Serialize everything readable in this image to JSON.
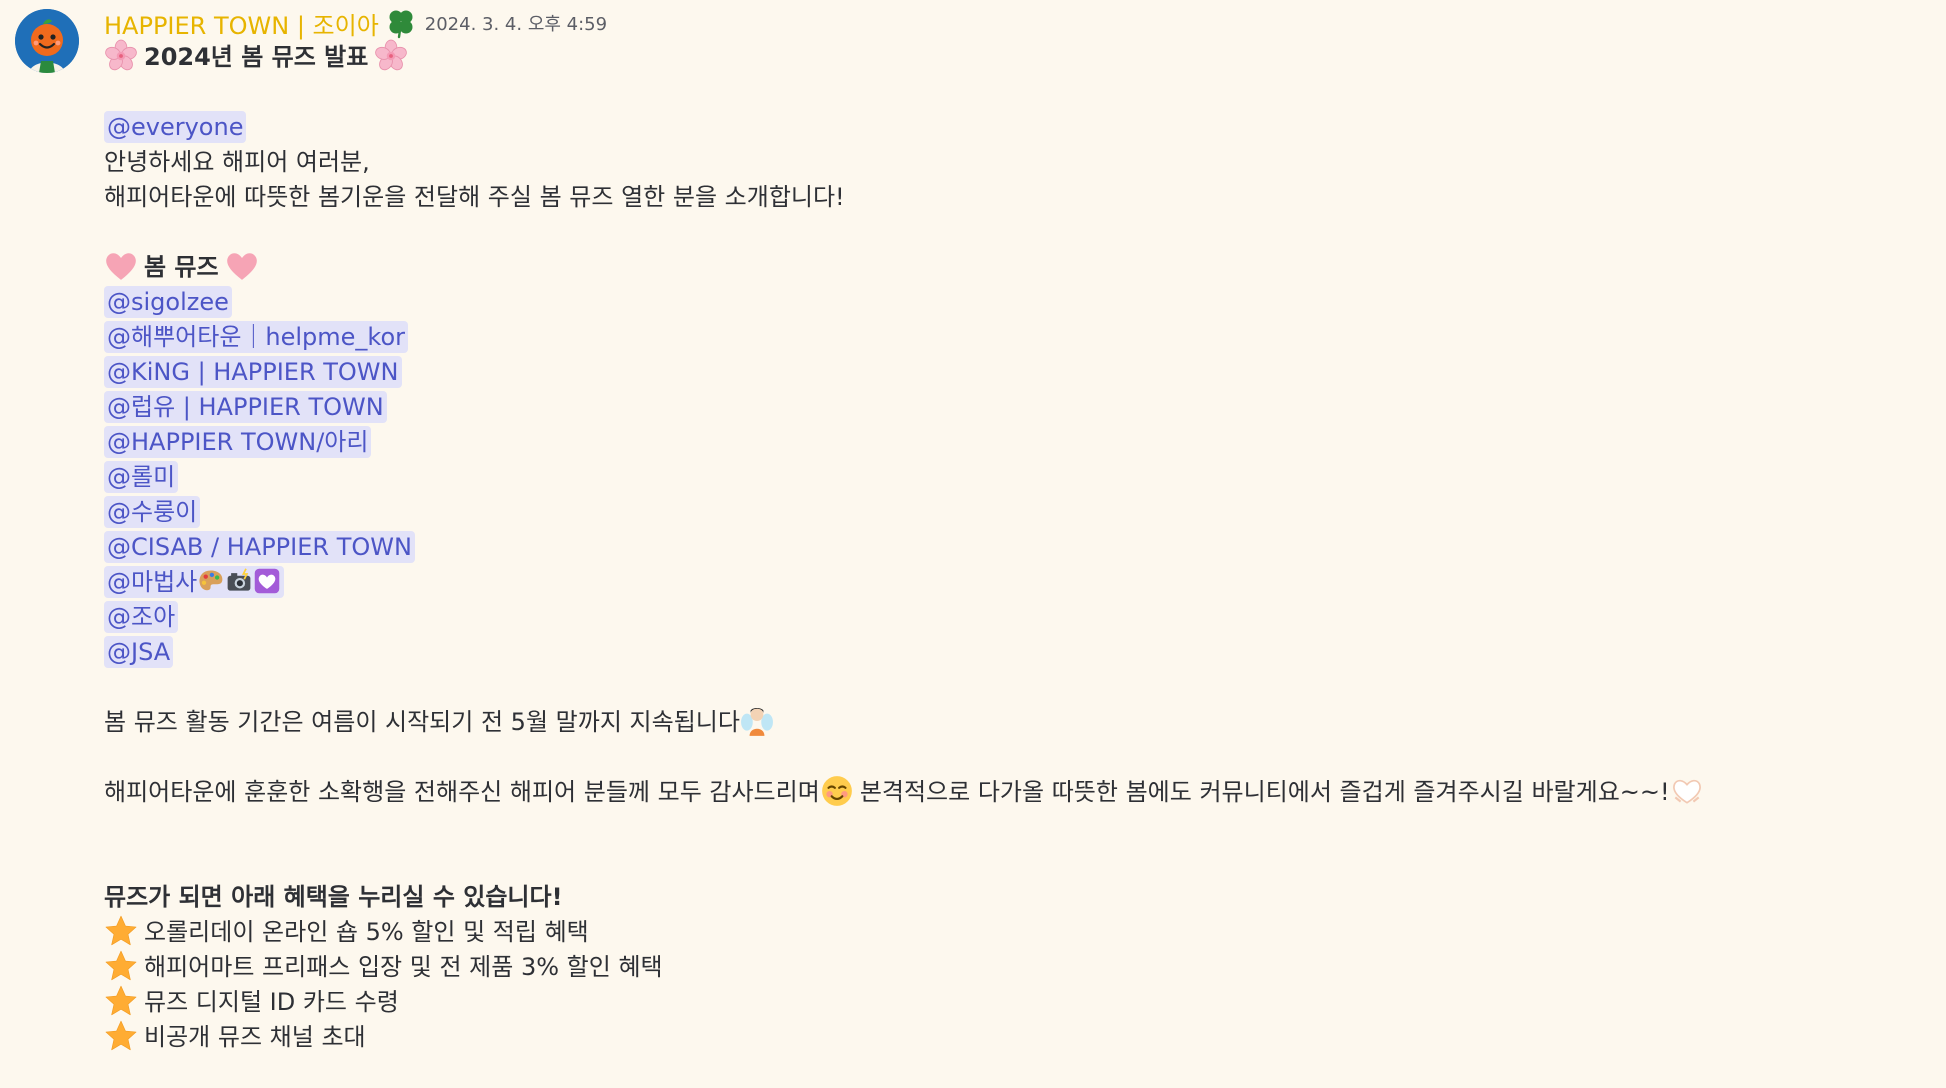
{
  "message": {
    "author": "HAPPIER TOWN | 조이아",
    "timestamp": "2024. 3. 4. 오후 4:59",
    "title": "2024년 봄 뮤즈 발표",
    "everyone": "@everyone",
    "greeting": "안녕하세요 해피어 여러분,",
    "intro": "해피어타운에 따뜻한 봄기운을 전달해 주실 봄 뮤즈 열한 분을 소개합니다!",
    "section_title": "봄 뮤즈",
    "mentions": [
      "@sigolzee",
      "@해뿌어타운｜helpme_kor",
      "@KiNG | HAPPIER TOWN",
      "@럽유 | HAPPIER TOWN",
      "@HAPPIER TOWN/아리",
      "@롤미",
      "@수룽이",
      "@CISAB / HAPPIER TOWN",
      "@마법사",
      "@조아",
      "@JSA"
    ],
    "period": "봄 뮤즈 활동 기간은 여름이 시작되기 전 5월 말까지 지속됩니다",
    "thanks_1": "해피어타운에 훈훈한 소확행을 전해주신 해피어 분들께 모두 감사드리며",
    "thanks_2": "본격적으로 다가올 따뜻한 봄에도 커뮤니티에서 즐겁게 즐겨주시길 바랄게요~~!",
    "benefits_title": "뮤즈가 되면 아래 혜택을 누리실 수 있습니다!",
    "benefits": [
      "오롤리데이 온라인 숍 5% 할인 및 적립 혜택",
      "해피어마트 프리패스 입장 및 전 제품 3% 할인 혜택",
      "뮤즈 디지털 ID 카드 수령",
      "비공개 뮤즈 채널 초대"
    ],
    "emojis": {
      "title": "cherry-blossom",
      "section": "pink-heart",
      "mention_9": [
        "artist-palette",
        "camera-with-flash",
        "heart-decoration"
      ],
      "period": "fairy",
      "thanks_1": "smiling-face",
      "thanks_2": "white-heart-hands",
      "benefit": "star"
    },
    "colors": {
      "background": "#fdf8ee",
      "author": "#e7b400",
      "mention_bg": "#e2e2f8",
      "mention_text": "#4c55c6"
    }
  }
}
